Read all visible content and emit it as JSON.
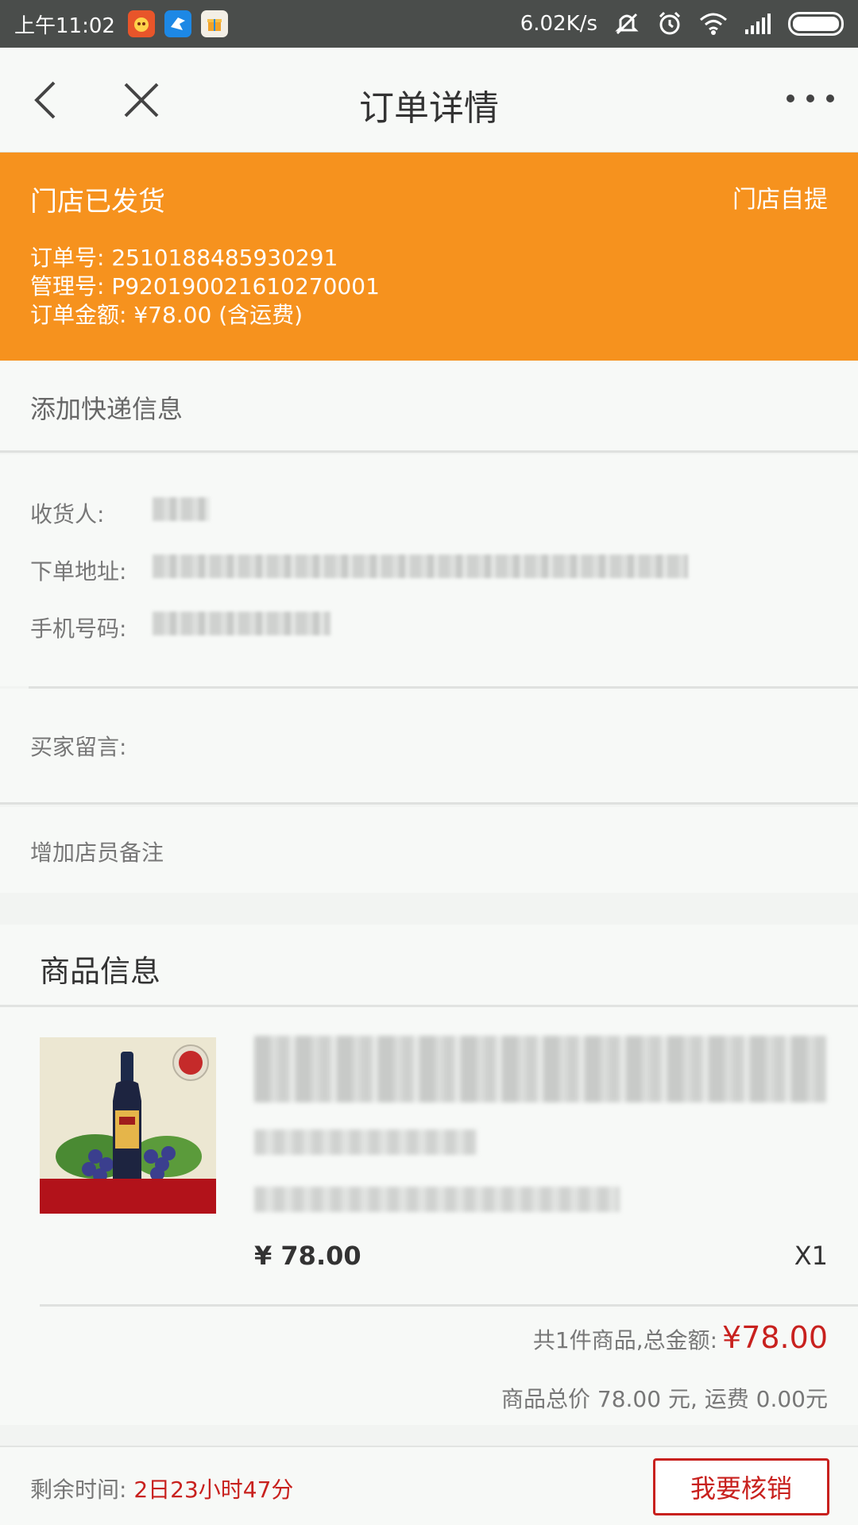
{
  "statusbar": {
    "time": "上午11:02",
    "speed": "6.02K/s",
    "icons": [
      "vibrate-off-icon",
      "alarm-icon",
      "wifi-icon",
      "signal-icon",
      "battery-icon"
    ]
  },
  "titlebar": {
    "title": "订单详情",
    "back_icon": "back-arrow-icon",
    "close_icon": "close-icon",
    "more_icon": "more-icon"
  },
  "order": {
    "status": "门店已发货",
    "delivery": "门店自提",
    "order_no_line": "订单号: 2510188485930291",
    "manage_no_line": "管理号: P920190021610270001",
    "amount_line": "订单金额: ¥78.00 (含运费)"
  },
  "express": {
    "label": "添加快递信息"
  },
  "receiver": {
    "name_label": "收货人:",
    "address_label": "下单地址:",
    "phone_label": "手机号码:"
  },
  "message": {
    "label": "买家留言:"
  },
  "note": {
    "label": "增加店员备注"
  },
  "goods": {
    "section_title": "商品信息",
    "price": "¥ 78.00",
    "quantity": "X1",
    "total_prefix": "共1件商品,总金额:",
    "total_amount": "¥78.00",
    "summary": "商品总价 78.00 元, 运费 0.00元"
  },
  "bottom": {
    "remain_label": "剩余时间:",
    "remain_value": "2日23小时47分",
    "action": "我要核销"
  },
  "colors": {
    "accent_orange": "#f6921e",
    "price_red": "#c8211e"
  }
}
